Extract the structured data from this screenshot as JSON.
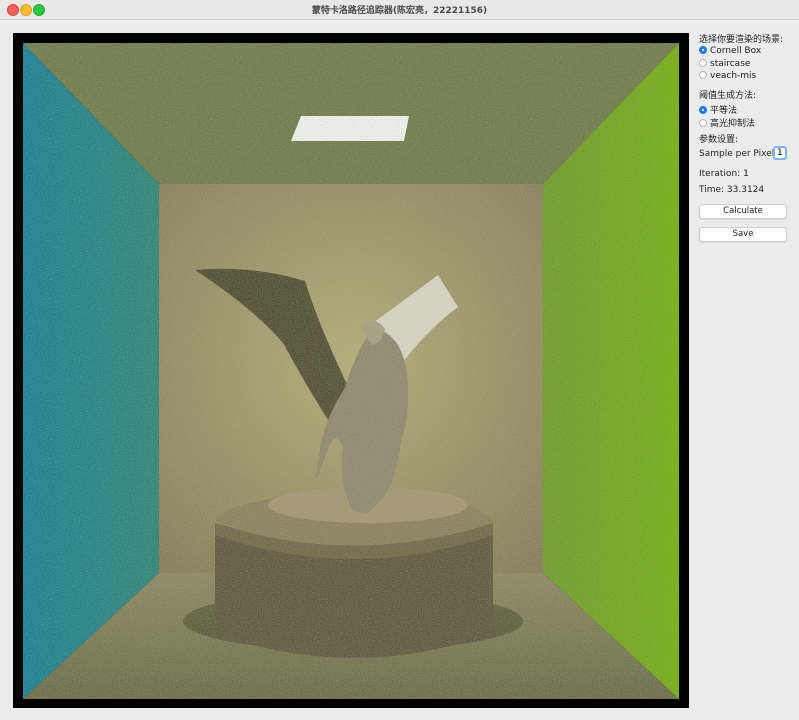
{
  "window": {
    "title": "蒙特卡洛路径追踪器(陈宏亮，22221156)"
  },
  "panel": {
    "scene_label": "选择你要渲染的场景:",
    "scenes": [
      {
        "label": "Cornell Box",
        "checked": true
      },
      {
        "label": "staircase",
        "checked": false
      },
      {
        "label": "veach-mis",
        "checked": false
      }
    ],
    "threshold_label": "阈值生成方法:",
    "threshold_methods": [
      {
        "label": "平等法",
        "checked": true
      },
      {
        "label": "高光抑制法",
        "checked": false
      }
    ],
    "params_label": "参数设置:",
    "spp_label": "Sample per Pixel:",
    "spp_value": "1",
    "iteration_text": "Iteration: 1",
    "time_text": "Time: 33.3124",
    "calculate_label": "Calculate",
    "save_label": "Save"
  },
  "colors": {
    "left_wall": "#1f7f8f",
    "right_wall": "#6aa41c",
    "back_wall": "#9d9465",
    "ceiling": "#6e7a4a",
    "floor": "#6f6d4a",
    "light": "#f4f4f4",
    "accent": "#1f7cf2"
  }
}
